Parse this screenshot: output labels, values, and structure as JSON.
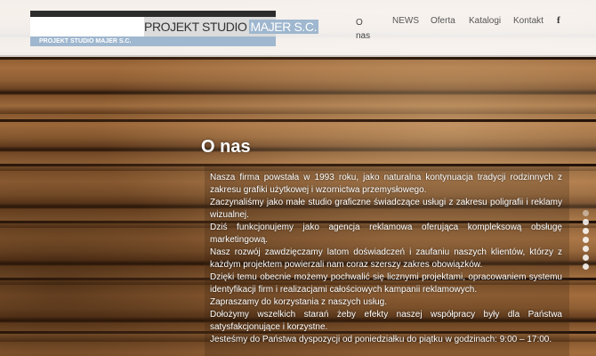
{
  "logo": {
    "main_part1": "PROJEKT STUDIO",
    "main_part2": "MAJER S.C.",
    "subtitle": "PROJEKT STUDIO MAJER S.C."
  },
  "nav": {
    "items": [
      {
        "label": "O nas",
        "active": true
      },
      {
        "label": "NEWS",
        "active": false
      },
      {
        "label": "Oferta",
        "active": false
      },
      {
        "label": "Katalogi",
        "active": false
      },
      {
        "label": "Kontakt",
        "active": false
      }
    ],
    "social_icon": "facebook-icon",
    "social_glyph": "f"
  },
  "content": {
    "title": "O nas",
    "paragraphs": [
      "Nasza firma powstała w 1993 roku, jako naturalna kontynuacja tradycji rodzinnych z zakresu grafiki użytkowej i wzornictwa przemysłowego.",
      "Zaczynaliśmy jako małe studio graficzne świadczące usługi z zakresu poligrafii i reklamy wizualnej.",
      "Dziś funkcjonujemy jako agencja reklamowa oferująca kompleksową obsługę marketingową.",
      "Nasz rozwój zawdzięczamy latom doświadczeń i zaufaniu naszych klientów, którzy z każdym projektem powierzali nam coraz szerszy zakres obowiązków.",
      "Dzięki temu obecnie możemy pochwalić się licznymi projektami, opracowaniem systemu identyfikacji firm i realizacjami całościowych kampanii reklamowych.",
      "Zapraszamy do korzystania z naszych usług.",
      "Dołożymy wszelkich starań żeby efekty naszej współpracy były dla Państwa satysfakcjonujące i korzystne.",
      "Jesteśmy do Państwa dyspozycji od poniedziałku do piątku w godzinach: 9:00 – 17:00."
    ]
  },
  "slider": {
    "count": 7,
    "active_index": 0
  }
}
